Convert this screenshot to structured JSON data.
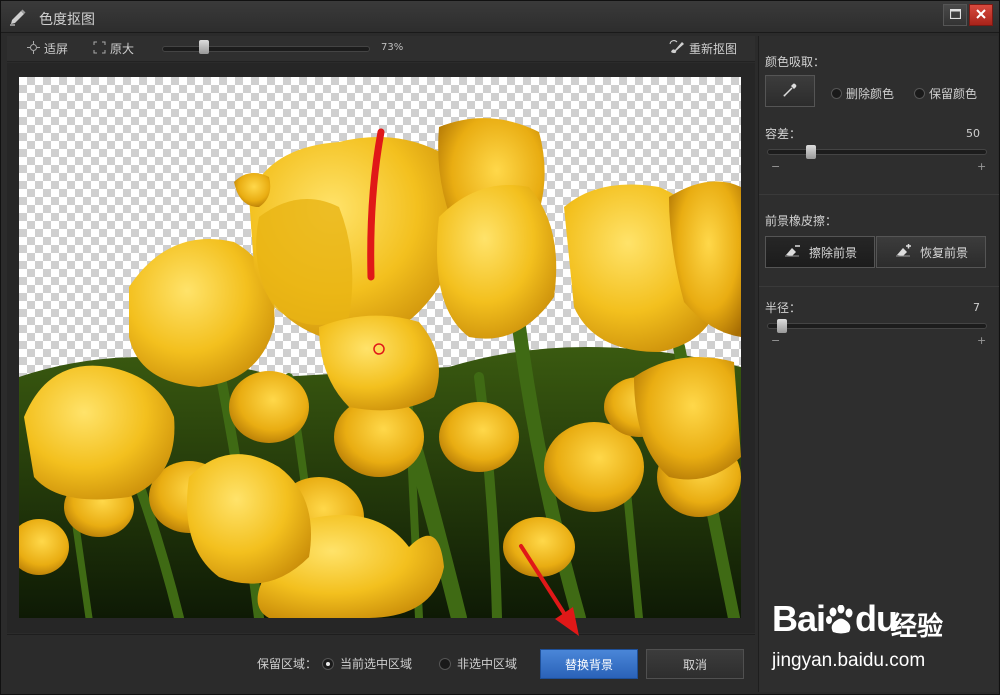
{
  "window": {
    "title": "色度抠图"
  },
  "toolbar": {
    "fit_label": "适屏",
    "original_label": "原大",
    "zoom_percent": "73%",
    "zoom_value": 0.2,
    "reset_label": "重新抠图"
  },
  "bottom": {
    "keep_area_label": "保留区域：",
    "option_current": "当前选中区域",
    "option_non_selected": "非选中区域",
    "selected_option": "current",
    "replace_button": "替换背景",
    "cancel_button": "取消"
  },
  "panel": {
    "color_pick_label": "颜色吸取：",
    "delete_color": "删除颜色",
    "keep_color": "保留颜色",
    "selected_color_mode": "delete",
    "tolerance_label": "容差：",
    "tolerance_value": "50",
    "tolerance_fraction": 0.2,
    "minus": "−",
    "plus": "+",
    "eraser_label": "前景橡皮擦：",
    "erase_foreground": "擦除前景",
    "restore_foreground": "恢复前景",
    "active_eraser": "erase",
    "radius_label": "半径：",
    "radius_value": "7",
    "radius_fraction": 0.07
  },
  "watermark": {
    "brand": "Bai",
    "brand_du": "du",
    "jingyan": "经验",
    "url": "jingyan.baidu.com"
  },
  "colors": {
    "accent_button": "#3a74c8",
    "tulip_yellow": "#f3c01e",
    "annotation_red": "#e01818"
  }
}
